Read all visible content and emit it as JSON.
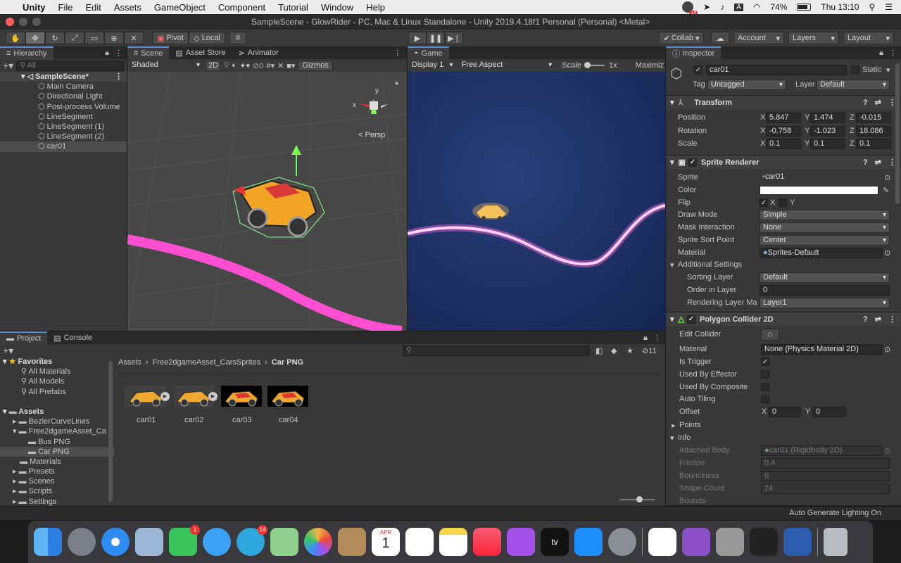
{
  "menubar": {
    "apple": "",
    "app": "Unity",
    "items": [
      "File",
      "Edit",
      "Assets",
      "GameObject",
      "Component",
      "Tutorial",
      "Window",
      "Help"
    ],
    "battery": "74%",
    "clock": "Thu 13:10",
    "badge_notif": "14"
  },
  "title": "SampleScene - GlowRider - PC, Mac & Linux Standalone - Unity 2019.4.18f1 Personal (Personal) <Metal>",
  "toolbar": {
    "pivot": "Pivot",
    "local": "Local",
    "collab": "Collab",
    "account": "Account",
    "layers": "Layers",
    "layout": "Layout"
  },
  "hierarchy": {
    "tab": "Hierarchy",
    "search_placeholder": "All",
    "scene": "SampleScene*",
    "items": [
      "Main Camera",
      "Directional Light",
      "Post-process Volume",
      "LineSegment",
      "LineSegment (1)",
      "LineSegment (2)",
      "car01"
    ],
    "selected": "car01"
  },
  "scene": {
    "tabs": [
      "Scene",
      "Asset Store",
      "Animator"
    ],
    "shading": "Shaded",
    "mode_2d": "2D",
    "fx_count": "0",
    "gizmos": "Gizmos",
    "persp": "Persp",
    "axis_y": "y",
    "axis_x": "x"
  },
  "game": {
    "tab": "Game",
    "display": "Display 1",
    "aspect": "Free Aspect",
    "scale_label": "Scale",
    "scale_value": "1x",
    "maximize": "Maximiz"
  },
  "project": {
    "tabs": [
      "Project",
      "Console"
    ],
    "hidden_count": "11",
    "favorites_label": "Favorites",
    "favorites": [
      "All Materials",
      "All Models",
      "All Prefabs"
    ],
    "assets_label": "Assets",
    "folders": [
      "BezierCurveLines",
      "Free2dgameAsset_Ca",
      "Bus PNG",
      "Car PNG",
      "Materials",
      "Presets",
      "Scenes",
      "Scripts",
      "Settings"
    ],
    "breadcrumb": [
      "Assets",
      "Free2dgameAsset_CarsSprites",
      "Car PNG"
    ],
    "files": [
      "car01",
      "car02",
      "car03",
      "car04"
    ]
  },
  "inspector": {
    "tab": "Inspector",
    "object_name": "car01",
    "static": "Static",
    "tag_label": "Tag",
    "tag": "Untagged",
    "layer_label": "Layer",
    "layer": "Default",
    "transform": {
      "title": "Transform",
      "position_label": "Position",
      "rotation_label": "Rotation",
      "scale_label": "Scale",
      "position": [
        "5.847",
        "1.474",
        "-0.015"
      ],
      "rotation": [
        "-0.758",
        "-1.023",
        "18.086"
      ],
      "scale": [
        "0.1",
        "0.1",
        "0.1"
      ],
      "x": "X",
      "y": "Y",
      "z": "Z"
    },
    "sprite_renderer": {
      "title": "Sprite Renderer",
      "sprite_label": "Sprite",
      "sprite": "car01",
      "color_label": "Color",
      "flip_label": "Flip",
      "flip_x": "X",
      "flip_y": "Y",
      "draw_mode_label": "Draw Mode",
      "draw_mode": "Simple",
      "mask_label": "Mask Interaction",
      "mask": "None",
      "sort_point_label": "Sprite Sort Point",
      "sort_point": "Center",
      "material_label": "Material",
      "material": "Sprites-Default",
      "additional": "Additional Settings",
      "sorting_layer_label": "Sorting Layer",
      "sorting_layer": "Default",
      "order_label": "Order in Layer",
      "order": "0",
      "rendering_layer_label": "Rendering Layer Ma",
      "rendering_layer": "Layer1"
    },
    "collider": {
      "title": "Polygon Collider 2D",
      "edit_label": "Edit Collider",
      "material_label": "Material",
      "material": "None (Physics Material 2D)",
      "is_trigger_label": "Is Trigger",
      "effector_label": "Used By Effector",
      "composite_label": "Used By Composite",
      "auto_tiling_label": "Auto Tiling",
      "offset_label": "Offset",
      "offset_x": "0",
      "offset_y": "0",
      "points_label": "Points",
      "info_label": "Info",
      "attached_label": "Attached Body",
      "attached": "car01 (Rigidbody 2D)",
      "friction_label": "Friction",
      "friction": "0.4",
      "bounciness_label": "Bounciness",
      "bounciness": "0",
      "shape_count_label": "Shape Count",
      "shape_count": "24",
      "bounds_label": "Bounds"
    }
  },
  "status": "Auto Generate Lighting On",
  "dock": {
    "badges": {
      "facetime": "1",
      "telegram": "14"
    },
    "calendar_month": "APR",
    "calendar_day": "1"
  },
  "colors": {
    "accent": "#3d6aa8",
    "line_pink": "#ff4fd0",
    "game_bg": "#1c2f63",
    "scene_bg": "#444444"
  }
}
